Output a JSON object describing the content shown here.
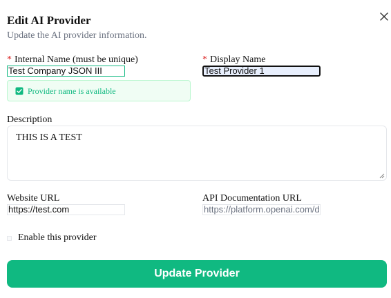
{
  "dialog": {
    "title": "Edit AI Provider",
    "subtitle": "Update the AI provider information.",
    "close_icon": "close-icon"
  },
  "form": {
    "internal_name": {
      "required_marker": "*",
      "label": "Internal Name (must be unique)",
      "value": "Test Company JSON III"
    },
    "availability": {
      "icon": "check-square-icon",
      "text": "Provider name is available",
      "color": "#10b981"
    },
    "display_name": {
      "required_marker": "*",
      "label": "Display Name",
      "value": "Test Provider 1"
    },
    "description": {
      "label": "Description",
      "value": "THIS IS A TEST"
    },
    "website_url": {
      "label": "Website URL",
      "value": "https://test.com"
    },
    "api_doc_url": {
      "label": "API Documentation URL",
      "placeholder": "https://platform.openai.com/docs"
    },
    "enable": {
      "label": "Enable this provider",
      "checked": false
    },
    "submit_label": "Update Provider"
  },
  "colors": {
    "accent": "#10b981",
    "required": "#dc2626",
    "muted_text": "#6b7280"
  }
}
